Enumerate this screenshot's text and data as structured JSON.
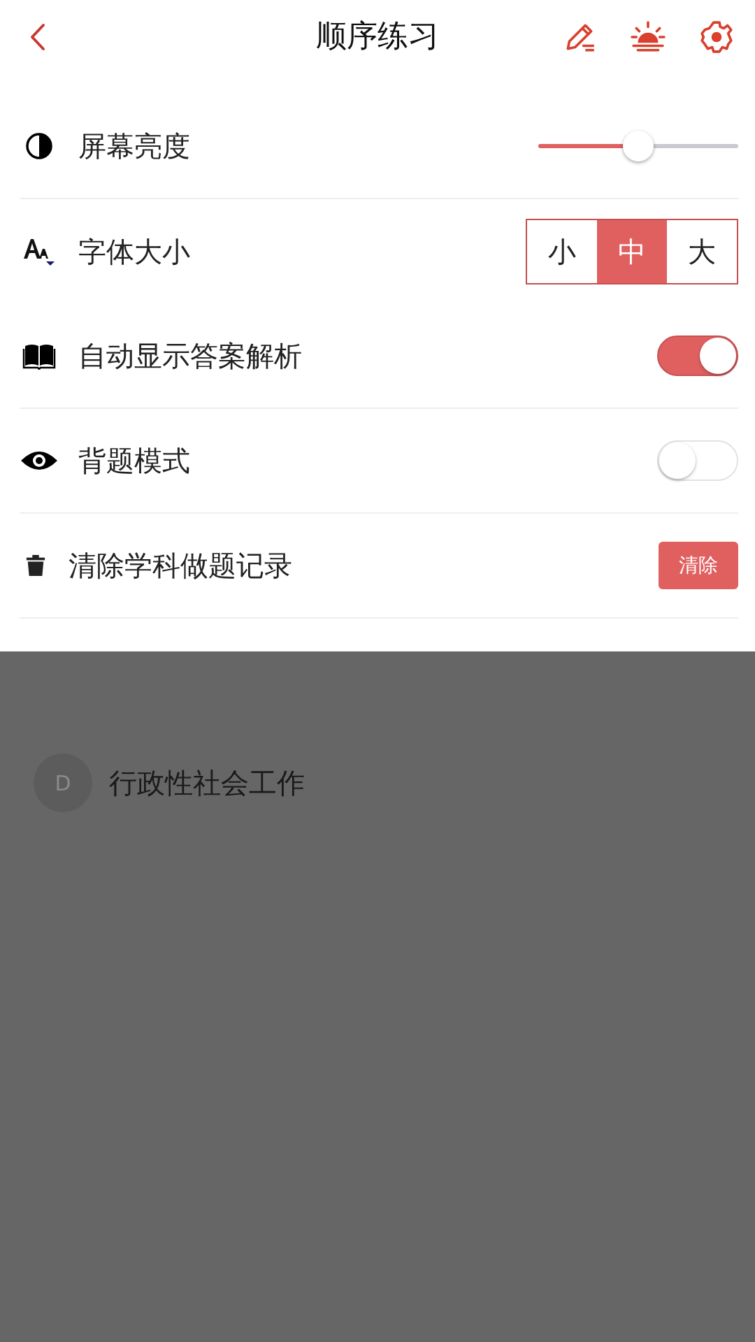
{
  "header": {
    "title": "顺序练习"
  },
  "settings": [
    {
      "kind": "slider",
      "label": "屏幕亮度",
      "level": 0.5,
      "divider": true
    },
    {
      "kind": "segmented",
      "label": "字体大小",
      "options": [
        {
          "label": "小",
          "selected": false
        },
        {
          "label": "中",
          "selected": true
        },
        {
          "label": "大",
          "selected": false
        }
      ],
      "divider": false
    },
    {
      "kind": "toggle",
      "label": "自动显示答案解析",
      "on": true,
      "divider": true
    },
    {
      "kind": "toggle",
      "label": "背题模式",
      "on": false,
      "divider": true
    },
    {
      "kind": "action",
      "label": "清除学科做题记录",
      "button": "清除",
      "divider": true
    }
  ],
  "background_options": [
    {
      "letter": "D",
      "text": "行政性社会工作"
    }
  ]
}
